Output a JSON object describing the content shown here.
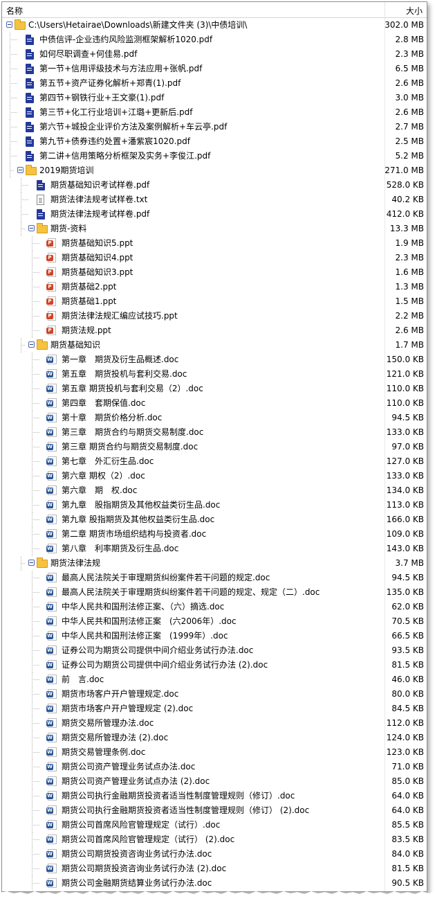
{
  "header": {
    "name": "名称",
    "size": "大小"
  },
  "rows": [
    {
      "level": 0,
      "type": "folder",
      "name": "C:\\Users\\Hetairae\\Downloads\\新建文件夹 (3)\\中债培训\\",
      "size": "302.0 MB",
      "expanded": true
    },
    {
      "level": 1,
      "type": "pdf",
      "name": "中债信评-企业违约风险监测框架解析1020.pdf",
      "size": "2.8 MB"
    },
    {
      "level": 1,
      "type": "pdf",
      "name": "如何尽职调查+何佳易.pdf",
      "size": "2.3 MB"
    },
    {
      "level": 1,
      "type": "pdf",
      "name": "第一节+信用评级技术与方法应用+张帆.pdf",
      "size": "6.5 MB"
    },
    {
      "level": 1,
      "type": "pdf",
      "name": "第五节+资产证券化解析+郑青(1).pdf",
      "size": "2.6 MB"
    },
    {
      "level": 1,
      "type": "pdf",
      "name": "第四节+钢铁行业+王文豪(1).pdf",
      "size": "3.0 MB"
    },
    {
      "level": 1,
      "type": "pdf",
      "name": "第三节+化工行业培训+江璐+更新后.pdf",
      "size": "2.6 MB"
    },
    {
      "level": 1,
      "type": "pdf",
      "name": "第六节+城投企业评价方法及案例解析+车云亭.pdf",
      "size": "2.7 MB"
    },
    {
      "level": 1,
      "type": "pdf",
      "name": "第九节+债券违约处置+潘紫宸1020.pdf",
      "size": "2.5 MB"
    },
    {
      "level": 1,
      "type": "pdf",
      "name": "第二讲+信用策略分析框架及实务+李俊江.pdf",
      "size": "5.2 MB"
    },
    {
      "level": 1,
      "type": "folder",
      "name": "2019期货培训",
      "size": "271.0 MB",
      "expanded": true
    },
    {
      "level": 2,
      "type": "pdf",
      "name": "期货基础知识考试样卷.pdf",
      "size": "528.0 KB"
    },
    {
      "level": 2,
      "type": "txt",
      "name": "期货法律法规考试样卷.txt",
      "size": "40.2 KB"
    },
    {
      "level": 2,
      "type": "pdf",
      "name": "期货法律法规考试样卷.pdf",
      "size": "412.0 KB"
    },
    {
      "level": 2,
      "type": "folder",
      "name": "期货-资料",
      "size": "13.3 MB",
      "expanded": true
    },
    {
      "level": 3,
      "type": "ppt",
      "name": "期货基础知识5.ppt",
      "size": "1.9 MB"
    },
    {
      "level": 3,
      "type": "ppt",
      "name": "期货基础知识4.ppt",
      "size": "2.3 MB"
    },
    {
      "level": 3,
      "type": "ppt",
      "name": "期货基础知识3.ppt",
      "size": "1.6 MB"
    },
    {
      "level": 3,
      "type": "ppt",
      "name": "期货基础2.ppt",
      "size": "1.3 MB"
    },
    {
      "level": 3,
      "type": "ppt",
      "name": "期货基础1.ppt",
      "size": "1.5 MB"
    },
    {
      "level": 3,
      "type": "ppt",
      "name": "期货法律法规汇编应试技巧.ppt",
      "size": "2.2 MB"
    },
    {
      "level": 3,
      "type": "ppt",
      "name": "期货法规.ppt",
      "size": "2.6 MB"
    },
    {
      "level": 2,
      "type": "folder",
      "name": "期货基础知识",
      "size": "1.7 MB",
      "expanded": true
    },
    {
      "level": 3,
      "type": "doc",
      "name": "第一章　期货及衍生品概述.doc",
      "size": "150.0 KB"
    },
    {
      "level": 3,
      "type": "doc",
      "name": "第五章　期货投机与套利交易.doc",
      "size": "121.0 KB"
    },
    {
      "level": 3,
      "type": "doc",
      "name": "第五章 期货投机与套利交易（2）.doc",
      "size": "110.0 KB"
    },
    {
      "level": 3,
      "type": "doc",
      "name": "第四章　套期保值.doc",
      "size": "110.0 KB"
    },
    {
      "level": 3,
      "type": "doc",
      "name": "第十章　期货价格分析.doc",
      "size": "94.5 KB"
    },
    {
      "level": 3,
      "type": "doc",
      "name": "第三章　期货合约与期货交易制度.doc",
      "size": "133.0 KB"
    },
    {
      "level": 3,
      "type": "doc",
      "name": "第三章 期货合约与期货交易制度.doc",
      "size": "97.0 KB"
    },
    {
      "level": 3,
      "type": "doc",
      "name": "第七章　外汇衍生品.doc",
      "size": "127.0 KB"
    },
    {
      "level": 3,
      "type": "doc",
      "name": "第六章 期权（2）.doc",
      "size": "133.0 KB"
    },
    {
      "level": 3,
      "type": "doc",
      "name": "第六章　期　权.doc",
      "size": "134.0 KB"
    },
    {
      "level": 3,
      "type": "doc",
      "name": "第九章　股指期货及其他权益类衍生品.doc",
      "size": "113.0 KB"
    },
    {
      "level": 3,
      "type": "doc",
      "name": "第九章 股指期货及其他权益类衍生品.doc",
      "size": "166.0 KB"
    },
    {
      "level": 3,
      "type": "doc",
      "name": "第二章 期货市场组织结构与投资者.doc",
      "size": "109.0 KB"
    },
    {
      "level": 3,
      "type": "doc",
      "name": "第八章　利率期货及衍生品.doc",
      "size": "143.0 KB"
    },
    {
      "level": 2,
      "type": "folder",
      "name": "期货法律法规",
      "size": "3.7 MB",
      "expanded": true
    },
    {
      "level": 3,
      "type": "doc",
      "name": "最高人民法院关于审理期货纠纷案件若干问题的规定.doc",
      "size": "94.5 KB"
    },
    {
      "level": 3,
      "type": "doc",
      "name": "最高人民法院关于审理期货纠纷案件若干问题的规定、规定（二）.doc",
      "size": "135.0 KB"
    },
    {
      "level": 3,
      "type": "doc",
      "name": "中华人民共和国刑法修正案、（六）摘选.doc",
      "size": "62.0 KB"
    },
    {
      "level": 3,
      "type": "doc",
      "name": "中华人民共和国刑法修正案　(六2006年）.doc",
      "size": "70.5 KB"
    },
    {
      "level": 3,
      "type": "doc",
      "name": "中华人民共和国刑法修正案　(1999年）.doc",
      "size": "66.5 KB"
    },
    {
      "level": 3,
      "type": "doc",
      "name": "证券公司为期货公司提供中间介绍业务试行办法.doc",
      "size": "93.5 KB"
    },
    {
      "level": 3,
      "type": "doc",
      "name": "证券公司为期货公司提供中间介绍业务试行办法 (2).doc",
      "size": "81.5 KB"
    },
    {
      "level": 3,
      "type": "doc",
      "name": "前　言.doc",
      "size": "46.0 KB"
    },
    {
      "level": 3,
      "type": "doc",
      "name": "期货市场客户开户管理规定.doc",
      "size": "80.0 KB"
    },
    {
      "level": 3,
      "type": "doc",
      "name": "期货市场客户开户管理规定 (2).doc",
      "size": "84.5 KB"
    },
    {
      "level": 3,
      "type": "doc",
      "name": "期货交易所管理办法.doc",
      "size": "112.0 KB"
    },
    {
      "level": 3,
      "type": "doc",
      "name": "期货交易所管理办法 (2).doc",
      "size": "124.0 KB"
    },
    {
      "level": 3,
      "type": "doc",
      "name": "期货交易管理条例.doc",
      "size": "123.0 KB"
    },
    {
      "level": 3,
      "type": "doc",
      "name": "期货公司资产管理业务试点办法.doc",
      "size": "71.0 KB"
    },
    {
      "level": 3,
      "type": "doc",
      "name": "期货公司资产管理业务试点办法 (2).doc",
      "size": "85.0 KB"
    },
    {
      "level": 3,
      "type": "doc",
      "name": "期货公司执行金融期货投资者适当性制度管理规则（修订）.doc",
      "size": "64.0 KB"
    },
    {
      "level": 3,
      "type": "doc",
      "name": "期货公司执行金融期货投资者适当性制度管理规则（修订） (2).doc",
      "size": "64.0 KB"
    },
    {
      "level": 3,
      "type": "doc",
      "name": "期货公司首席风险官管理规定（试行）.doc",
      "size": "85.5 KB"
    },
    {
      "level": 3,
      "type": "doc",
      "name": "期货公司首席风险官管理规定（试行） (2).doc",
      "size": "83.5 KB"
    },
    {
      "level": 3,
      "type": "doc",
      "name": "期货公司期货投资咨询业务试行办法.doc",
      "size": "84.0 KB"
    },
    {
      "level": 3,
      "type": "doc",
      "name": "期货公司期货投资咨询业务试行办法 (2).doc",
      "size": "81.5 KB"
    },
    {
      "level": 3,
      "type": "doc",
      "name": "期货公司金融期货结算业务试行办法.doc",
      "size": "90.5 KB"
    }
  ]
}
